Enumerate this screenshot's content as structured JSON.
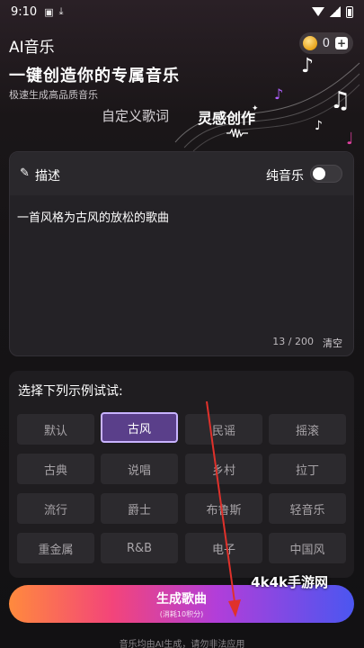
{
  "status_bar": {
    "time": "9:10"
  },
  "header": {
    "app_title": "AI音乐",
    "credits": "0",
    "headline": "一键创造你的专属音乐",
    "subline": "极速生成高品质音乐"
  },
  "tabs": [
    {
      "label": "自定义歌词",
      "active": false
    },
    {
      "label": "灵感创作",
      "active": true
    }
  ],
  "description_card": {
    "label": "描述",
    "pure_music_label": "纯音乐",
    "pure_music_on": false,
    "text": "一首风格为古风的放松的歌曲",
    "counter": "13 / 200",
    "clear_label": "清空"
  },
  "examples": {
    "title": "选择下列示例试试:",
    "chips": [
      {
        "label": "默认",
        "active": false
      },
      {
        "label": "古风",
        "active": true
      },
      {
        "label": "民谣",
        "active": false
      },
      {
        "label": "摇滚",
        "active": false
      },
      {
        "label": "古典",
        "active": false
      },
      {
        "label": "说唱",
        "active": false
      },
      {
        "label": "乡村",
        "active": false
      },
      {
        "label": "拉丁",
        "active": false
      },
      {
        "label": "流行",
        "active": false
      },
      {
        "label": "爵士",
        "active": false
      },
      {
        "label": "布鲁斯",
        "active": false
      },
      {
        "label": "轻音乐",
        "active": false
      },
      {
        "label": "重金属",
        "active": false
      },
      {
        "label": "R&B",
        "active": false
      },
      {
        "label": "电子",
        "active": false
      },
      {
        "label": "中国风",
        "active": false
      }
    ]
  },
  "generate": {
    "label": "生成歌曲",
    "cost": "(消耗10积分)"
  },
  "footer_note": "音乐均由AI生成，请勿非法应用",
  "watermark": "4k4k手游网",
  "colors": {
    "accent_purple": "#5a3f8a",
    "chip_border": "#c8b3ff",
    "annotation_red": "#e0312b"
  }
}
